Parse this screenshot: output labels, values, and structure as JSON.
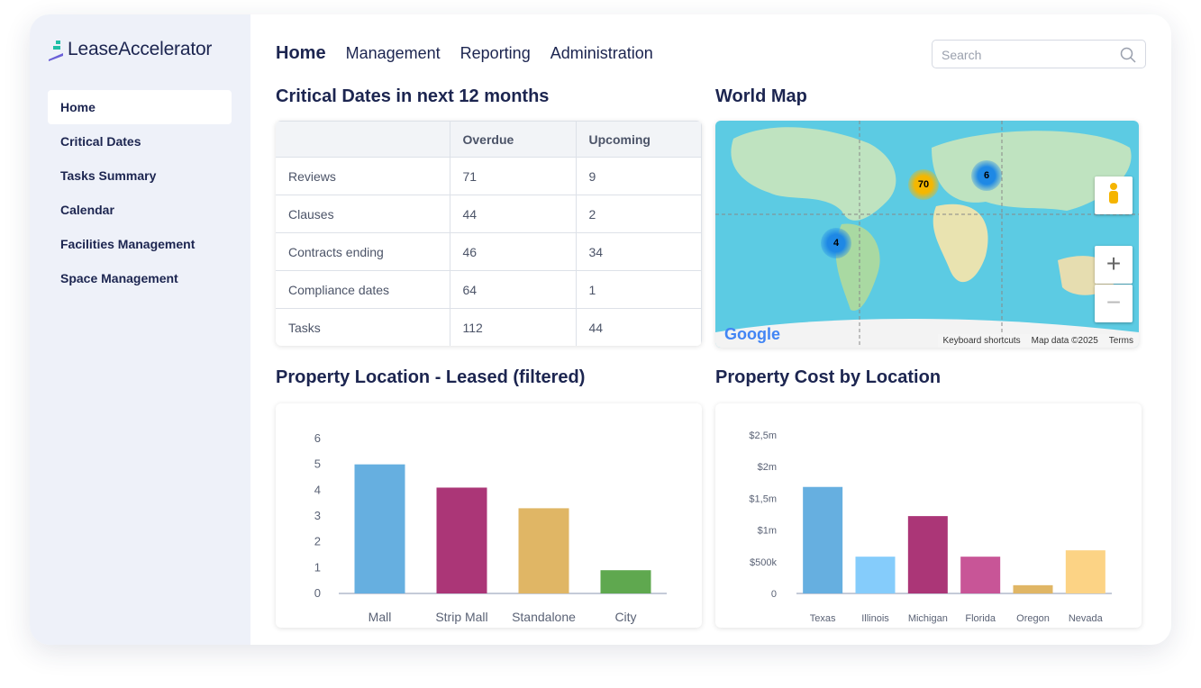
{
  "brand": "LeaseAccelerator",
  "sidebar": {
    "items": [
      {
        "label": "Home"
      },
      {
        "label": "Critical Dates"
      },
      {
        "label": "Tasks Summary"
      },
      {
        "label": "Calendar"
      },
      {
        "label": "Facilities Management"
      },
      {
        "label": "Space Management"
      }
    ]
  },
  "topnav": {
    "items": [
      {
        "label": "Home"
      },
      {
        "label": "Management"
      },
      {
        "label": "Reporting"
      },
      {
        "label": "Administration"
      }
    ]
  },
  "search": {
    "placeholder": "Search"
  },
  "critical": {
    "title": "Critical Dates in next 12 months",
    "headers": [
      "",
      "Overdue",
      "Upcoming"
    ],
    "rows": [
      [
        "Reviews",
        "71",
        "9"
      ],
      [
        "Clauses",
        "44",
        "2"
      ],
      [
        "Contracts ending",
        "46",
        "34"
      ],
      [
        "Compliance dates",
        "64",
        "1"
      ],
      [
        "Tasks",
        "112",
        "44"
      ]
    ]
  },
  "map": {
    "title": "World Map",
    "clusters": [
      "70",
      "6",
      "4"
    ],
    "google": "Google",
    "footer": [
      "Keyboard shortcuts",
      "Map data ©2025",
      "Terms"
    ]
  },
  "chart_data": [
    {
      "type": "bar",
      "title": "Property Location - Leased (filtered)",
      "categories": [
        "Mall",
        "Strip Mall",
        "Standalone",
        "City"
      ],
      "values": [
        5,
        4.1,
        3.3,
        0.9
      ],
      "ylim": [
        0,
        6
      ],
      "yticks": [
        "0",
        "1",
        "2",
        "3",
        "4",
        "5",
        "6"
      ],
      "colors": [
        "#66afe0",
        "#ab3677",
        "#e0b665",
        "#5fa84f"
      ]
    },
    {
      "type": "bar",
      "title": "Property Cost by Location",
      "categories": [
        "Texas",
        "Illinois",
        "Michigan",
        "Florida",
        "Oregon",
        "Nevada"
      ],
      "values": [
        1680000,
        580000,
        1220000,
        580000,
        130000,
        680000
      ],
      "ylim": [
        0,
        2500000
      ],
      "yticks": [
        "0",
        "$500k",
        "$1m",
        "$1,5m",
        "$2m",
        "$2,5m"
      ],
      "colors": [
        "#66afe0",
        "#85ccfb",
        "#ab3677",
        "#c85597",
        "#e0b665",
        "#fcd385"
      ]
    }
  ]
}
